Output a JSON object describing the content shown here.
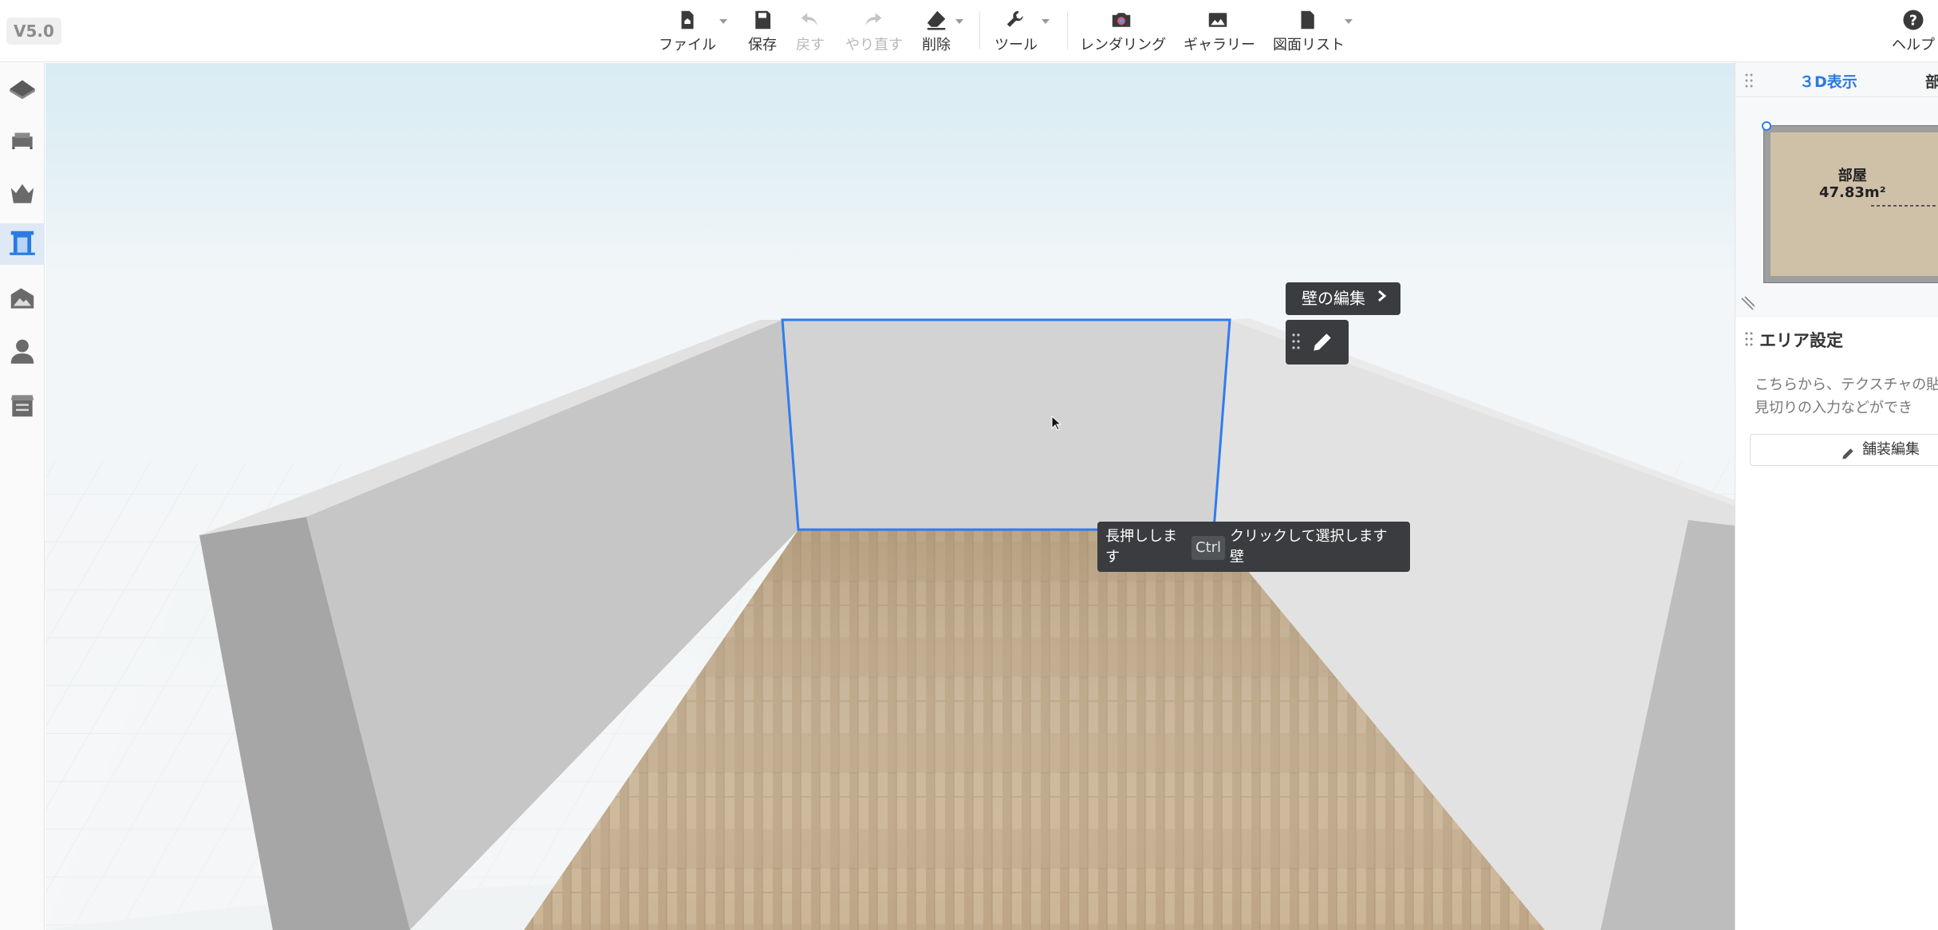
{
  "app": {
    "version": "V5.0"
  },
  "toolbar": {
    "file": "ファイル",
    "save": "保存",
    "undo": "戻す",
    "redo": "やり直す",
    "delete": "削除",
    "tools": "ツール",
    "rendering": "レンダリング",
    "gallery": "ギャラリー",
    "drawing_list": "図面リスト",
    "help": "ヘルプ"
  },
  "sidebar": {
    "items": [
      {
        "icon": "floor-plan-icon"
      },
      {
        "icon": "furniture-icon"
      },
      {
        "icon": "decoration-icon"
      },
      {
        "icon": "door-window-icon",
        "active": true
      },
      {
        "icon": "landscape-icon"
      },
      {
        "icon": "person-icon"
      },
      {
        "icon": "cabinet-icon"
      }
    ]
  },
  "viewport": {
    "wall_edit_label": "壁の編集",
    "tooltip": {
      "part1": "長押しします",
      "key": "Ctrl",
      "part2": "クリックして選択します 壁"
    }
  },
  "right_panel": {
    "tab_3d": "３D表示",
    "tab_room": "部",
    "room_name": "部屋",
    "room_area": "47.83m²",
    "area_settings_title": "エリア設定",
    "area_settings_desc": "こちらから、テクスチャの貼\n見切りの入力などができ",
    "paving_edit": "舗装編集"
  },
  "colors": {
    "accent": "#2a7ae2",
    "selection": "#2f7cf0",
    "tooltip_bg": "#3a3c3f",
    "floor_wood": "#c2ab8c",
    "wall": "#d4d4d4"
  }
}
